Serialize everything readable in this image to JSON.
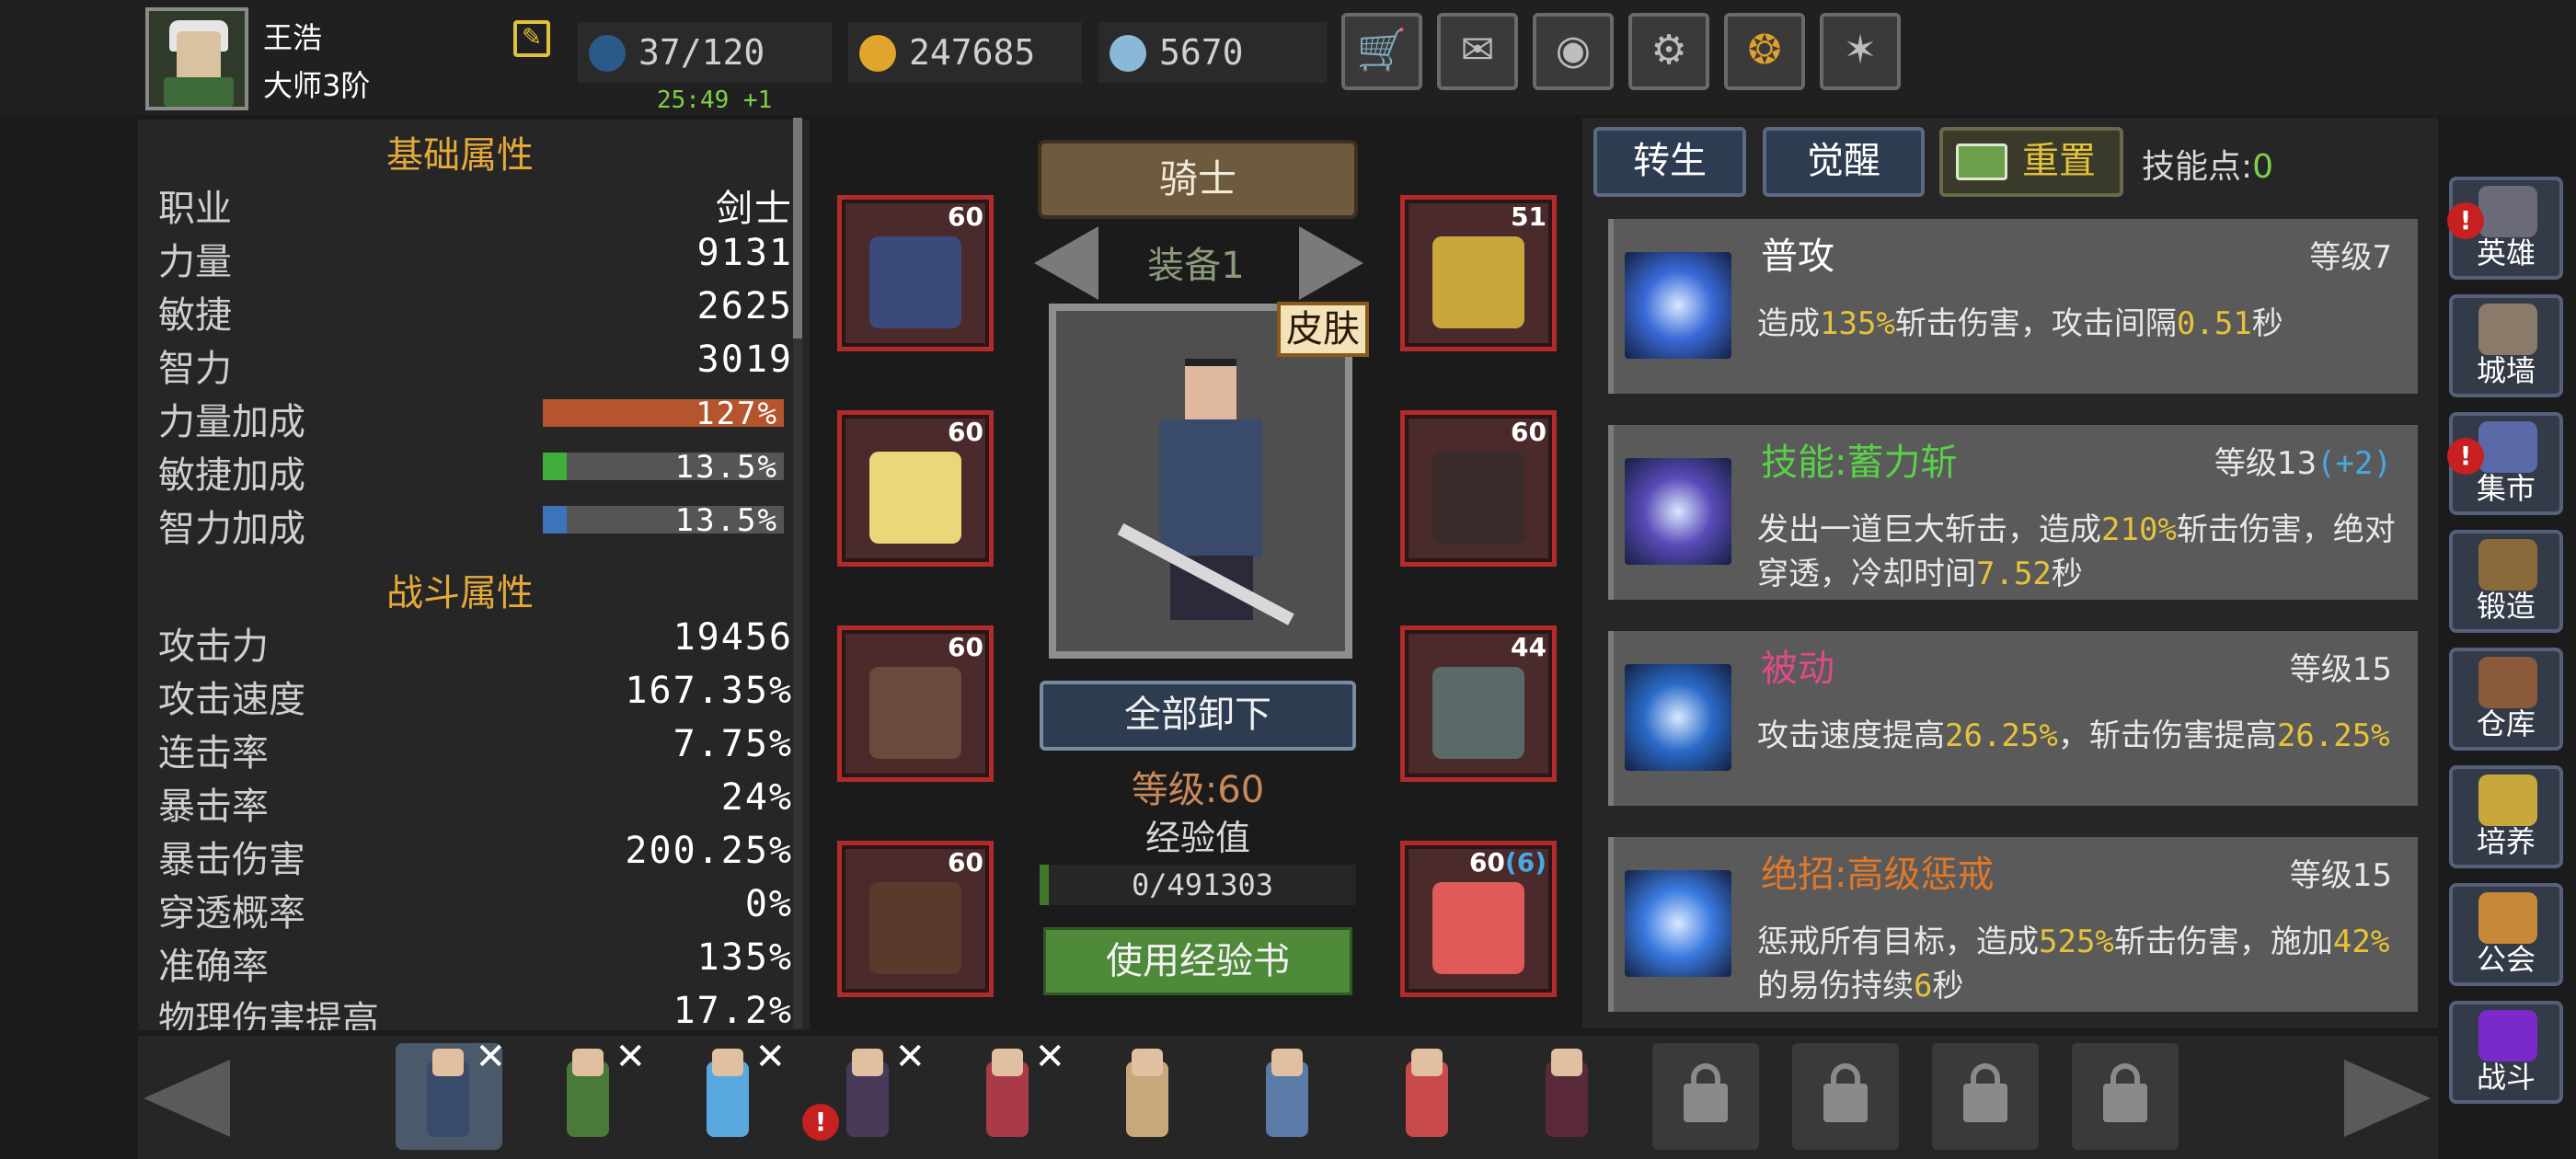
{
  "player": {
    "name": "王浩",
    "rank": "大师3阶"
  },
  "resources": {
    "energy": "37/120",
    "gold": "247685",
    "gems": "5670",
    "timer": "25:49 +1"
  },
  "top_buttons": [
    "cart-icon",
    "mail-icon",
    "gamepad-icon",
    "gear-icon",
    "color-wheel-icon",
    "fireworks-icon"
  ],
  "stats": {
    "basic_title": "基础属性",
    "basic": [
      {
        "label": "职业",
        "value": "剑士"
      },
      {
        "label": "力量",
        "value": "9131"
      },
      {
        "label": "敏捷",
        "value": "2625"
      },
      {
        "label": "智力",
        "value": "3019"
      }
    ],
    "bonuses": [
      {
        "label": "力量加成",
        "value": "127%",
        "fill": 1.0,
        "color": "#b5552e"
      },
      {
        "label": "敏捷加成",
        "value": "13.5%",
        "fill": 0.1,
        "color": "#3fae3a"
      },
      {
        "label": "智力加成",
        "value": "13.5%",
        "fill": 0.1,
        "color": "#3b74b8"
      }
    ],
    "combat_title": "战斗属性",
    "combat": [
      {
        "label": "攻击力",
        "value": "19456"
      },
      {
        "label": "攻击速度",
        "value": "167.35%"
      },
      {
        "label": "连击率",
        "value": "7.75%"
      },
      {
        "label": "暴击率",
        "value": "24%"
      },
      {
        "label": "暴击伤害",
        "value": "200.25%"
      },
      {
        "label": "穿透概率",
        "value": "0%"
      },
      {
        "label": "准确率",
        "value": "135%"
      },
      {
        "label": "物理伤害提高",
        "value": "17.2%"
      }
    ]
  },
  "equipment": {
    "class_name": "骑士",
    "set_label": "装备1",
    "skin_label": "皮肤",
    "unequip_label": "全部卸下",
    "level_text": "等级:60",
    "exp_label": "经验值",
    "exp_value": "0/491303",
    "use_exp_book": "使用经验书",
    "slots_left": [
      {
        "level": "60",
        "item": "helmet"
      },
      {
        "level": "60",
        "item": "cloak"
      },
      {
        "level": "60",
        "item": "pants"
      },
      {
        "level": "60",
        "item": "boots"
      }
    ],
    "slots_right": [
      {
        "level": "51",
        "item": "necklace"
      },
      {
        "level": "60",
        "item": "gloves"
      },
      {
        "level": "44",
        "item": "bracelet"
      },
      {
        "level": "60",
        "level_bonus": "(6)",
        "item": "sword"
      }
    ]
  },
  "skills_panel": {
    "tabs": [
      "转生",
      "觉醒"
    ],
    "reset_label": "重置",
    "skill_points_label": "技能点:",
    "skill_points_value": "0",
    "skills": [
      {
        "name": "普攻",
        "name_color": "#ffffff",
        "level": "等级7",
        "level_bonus": "",
        "desc": [
          "造成",
          "135%",
          "斩击伤害，攻击间隔",
          "0.51",
          "秒"
        ],
        "icon_color": "#3a6ad8"
      },
      {
        "name": "技能:蓄力斩",
        "name_color": "#5ad04a",
        "level": "等级13",
        "level_bonus": "(+2)",
        "desc": [
          "发出一道巨大斩击，造成",
          "210%",
          "斩击伤害，绝对穿透，冷却时间",
          "7.52",
          "秒"
        ],
        "icon_color": "#5a4ab8"
      },
      {
        "name": "被动",
        "name_color": "#e04a8a",
        "level": "等级15",
        "level_bonus": "",
        "desc": [
          "攻击速度提高",
          "26.25%",
          "，斩击伤害提高",
          "26.25%",
          ""
        ],
        "icon_color": "#2a6ac8"
      },
      {
        "name": "绝招:高级惩戒",
        "name_color": "#e0782a",
        "level": "等级15",
        "level_bonus": "",
        "desc": [
          "惩戒所有目标，造成",
          "525%",
          "斩击伤害，施加",
          "42%",
          "的易伤持续",
          "6",
          "秒"
        ],
        "icon_color": "#3a7ae0"
      }
    ]
  },
  "side_nav": [
    {
      "label": "英雄",
      "alert": true,
      "color": "#6a6a7a"
    },
    {
      "label": "城墙",
      "alert": false,
      "color": "#8a7a6a"
    },
    {
      "label": "集市",
      "alert": true,
      "color": "#5a6aa8"
    },
    {
      "label": "锻造",
      "alert": false,
      "color": "#8a6a3a"
    },
    {
      "label": "仓库",
      "alert": false,
      "color": "#8a5a3a"
    },
    {
      "label": "培养",
      "alert": false,
      "color": "#c8a83a"
    },
    {
      "label": "公会",
      "alert": false,
      "color": "#c8883a"
    },
    {
      "label": "战斗",
      "alert": false,
      "color": "#7a2ac8"
    }
  ],
  "heroes": [
    {
      "name": "knight",
      "removable": true,
      "selected": true,
      "alert": false,
      "color": "#3a4a6a"
    },
    {
      "name": "archer",
      "removable": true,
      "selected": false,
      "alert": false,
      "color": "#4a7a3a"
    },
    {
      "name": "ice-mage",
      "removable": true,
      "selected": false,
      "alert": false,
      "color": "#5aa8e0"
    },
    {
      "name": "dark-mage",
      "removable": true,
      "selected": false,
      "alert": true,
      "color": "#4a3a5a"
    },
    {
      "name": "sorceress",
      "removable": true,
      "selected": false,
      "alert": false,
      "color": "#a83a4a"
    },
    {
      "name": "amazon",
      "removable": false,
      "selected": false,
      "alert": false,
      "color": "#c8a87a"
    },
    {
      "name": "gunner",
      "removable": false,
      "selected": false,
      "alert": false,
      "color": "#5a7aa8"
    },
    {
      "name": "priest",
      "removable": false,
      "selected": false,
      "alert": false,
      "color": "#c84a4a"
    },
    {
      "name": "assassin",
      "removable": false,
      "selected": false,
      "alert": false,
      "color": "#5a2a3a"
    }
  ],
  "locked_heroes": 4
}
